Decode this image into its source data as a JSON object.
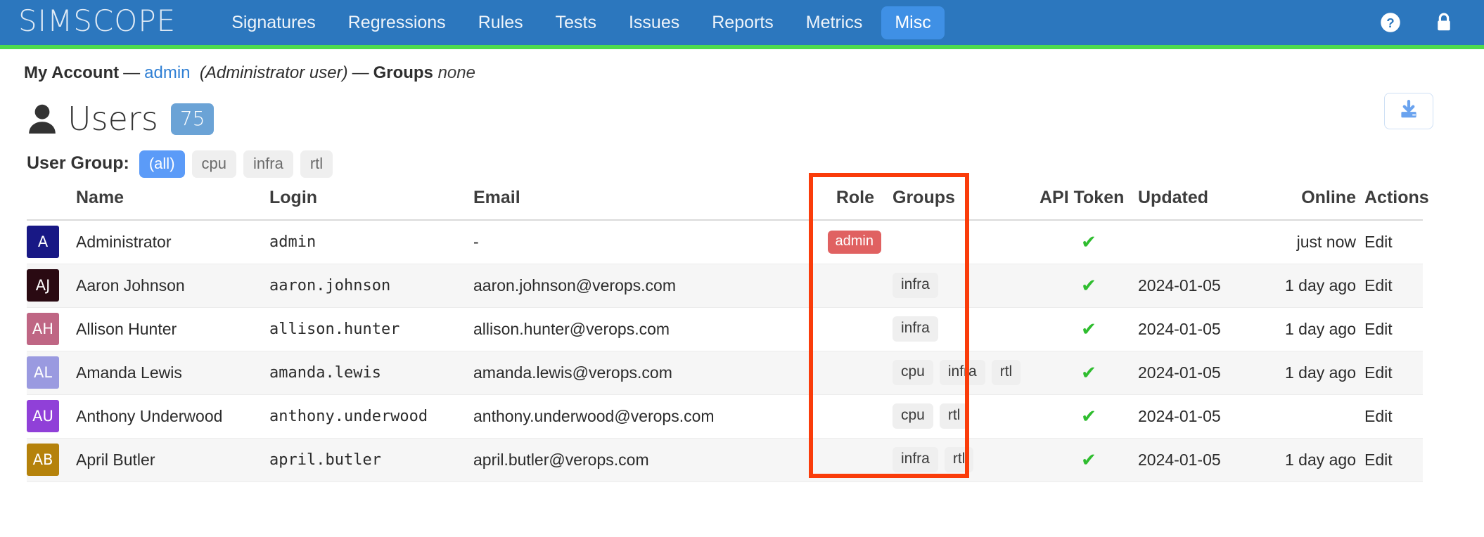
{
  "navbar": {
    "brand": "SIMSCOPE",
    "links": [
      {
        "label": "Signatures",
        "active": false
      },
      {
        "label": "Regressions",
        "active": false
      },
      {
        "label": "Rules",
        "active": false
      },
      {
        "label": "Tests",
        "active": false
      },
      {
        "label": "Issues",
        "active": false
      },
      {
        "label": "Reports",
        "active": false
      },
      {
        "label": "Metrics",
        "active": false
      },
      {
        "label": "Misc",
        "active": true
      }
    ],
    "icons": [
      "help-circle-icon",
      "lock-icon"
    ],
    "bg_color": "#2c77be",
    "active_color": "#3f90e5",
    "accent_color": "#4ddb4d"
  },
  "account": {
    "label": "My Account",
    "dash1": "—",
    "user": "admin",
    "role_note": "(Administrator user)",
    "dash2": "—",
    "groups_label": "Groups",
    "groups_value": "none"
  },
  "page": {
    "icon": "person-icon",
    "title": "Users",
    "count": "75",
    "count_color": "#6ba3d6",
    "download_button": "download-icon"
  },
  "filter": {
    "label": "User Group:",
    "options": [
      {
        "label": "(all)",
        "active": true
      },
      {
        "label": "cpu",
        "active": false
      },
      {
        "label": "infra",
        "active": false
      },
      {
        "label": "rtl",
        "active": false
      }
    ],
    "active_color": "#5b9bf8"
  },
  "table": {
    "headers": {
      "name": "Name",
      "login": "Login",
      "email": "Email",
      "role": "Role",
      "groups": "Groups",
      "api_token": "API Token",
      "updated": "Updated",
      "online": "Online",
      "actions": "Actions"
    },
    "rows": [
      {
        "initials": "A",
        "avatar_color": "#181885",
        "name": "Administrator",
        "login": "admin",
        "email": "-",
        "role": "admin",
        "groups": [],
        "api_token": "check-icon",
        "updated": "",
        "online": "just now",
        "action": "Edit"
      },
      {
        "initials": "AJ",
        "avatar_color": "#2a0a12",
        "name": "Aaron Johnson",
        "login": "aaron.johnson",
        "email": "aaron.johnson@verops.com",
        "role": "",
        "groups": [
          "infra"
        ],
        "api_token": "check-icon",
        "updated": "2024-01-05",
        "online": "1 day ago",
        "action": "Edit"
      },
      {
        "initials": "AH",
        "avatar_color": "#bf6684",
        "name": "Allison Hunter",
        "login": "allison.hunter",
        "email": "allison.hunter@verops.com",
        "role": "",
        "groups": [
          "infra"
        ],
        "api_token": "check-icon",
        "updated": "2024-01-05",
        "online": "1 day ago",
        "action": "Edit"
      },
      {
        "initials": "AL",
        "avatar_color": "#9a9ae0",
        "name": "Amanda Lewis",
        "login": "amanda.lewis",
        "email": "amanda.lewis@verops.com",
        "role": "",
        "groups": [
          "cpu",
          "infra",
          "rtl"
        ],
        "api_token": "check-icon",
        "updated": "2024-01-05",
        "online": "1 day ago",
        "action": "Edit"
      },
      {
        "initials": "AU",
        "avatar_color": "#9040d8",
        "name": "Anthony Underwood",
        "login": "anthony.underwood",
        "email": "anthony.underwood@verops.com",
        "role": "",
        "groups": [
          "cpu",
          "rtl"
        ],
        "api_token": "check-icon",
        "updated": "2024-01-05",
        "online": "",
        "action": "Edit"
      },
      {
        "initials": "AB",
        "avatar_color": "#b5820b",
        "name": "April Butler",
        "login": "april.butler",
        "email": "april.butler@verops.com",
        "role": "",
        "groups": [
          "infra",
          "rtl"
        ],
        "api_token": "check-icon",
        "updated": "2024-01-05",
        "online": "1 day ago",
        "action": "Edit"
      }
    ]
  },
  "annotation": {
    "type": "highlight-box",
    "target_column": "Groups",
    "color": "#fa3c0a"
  }
}
